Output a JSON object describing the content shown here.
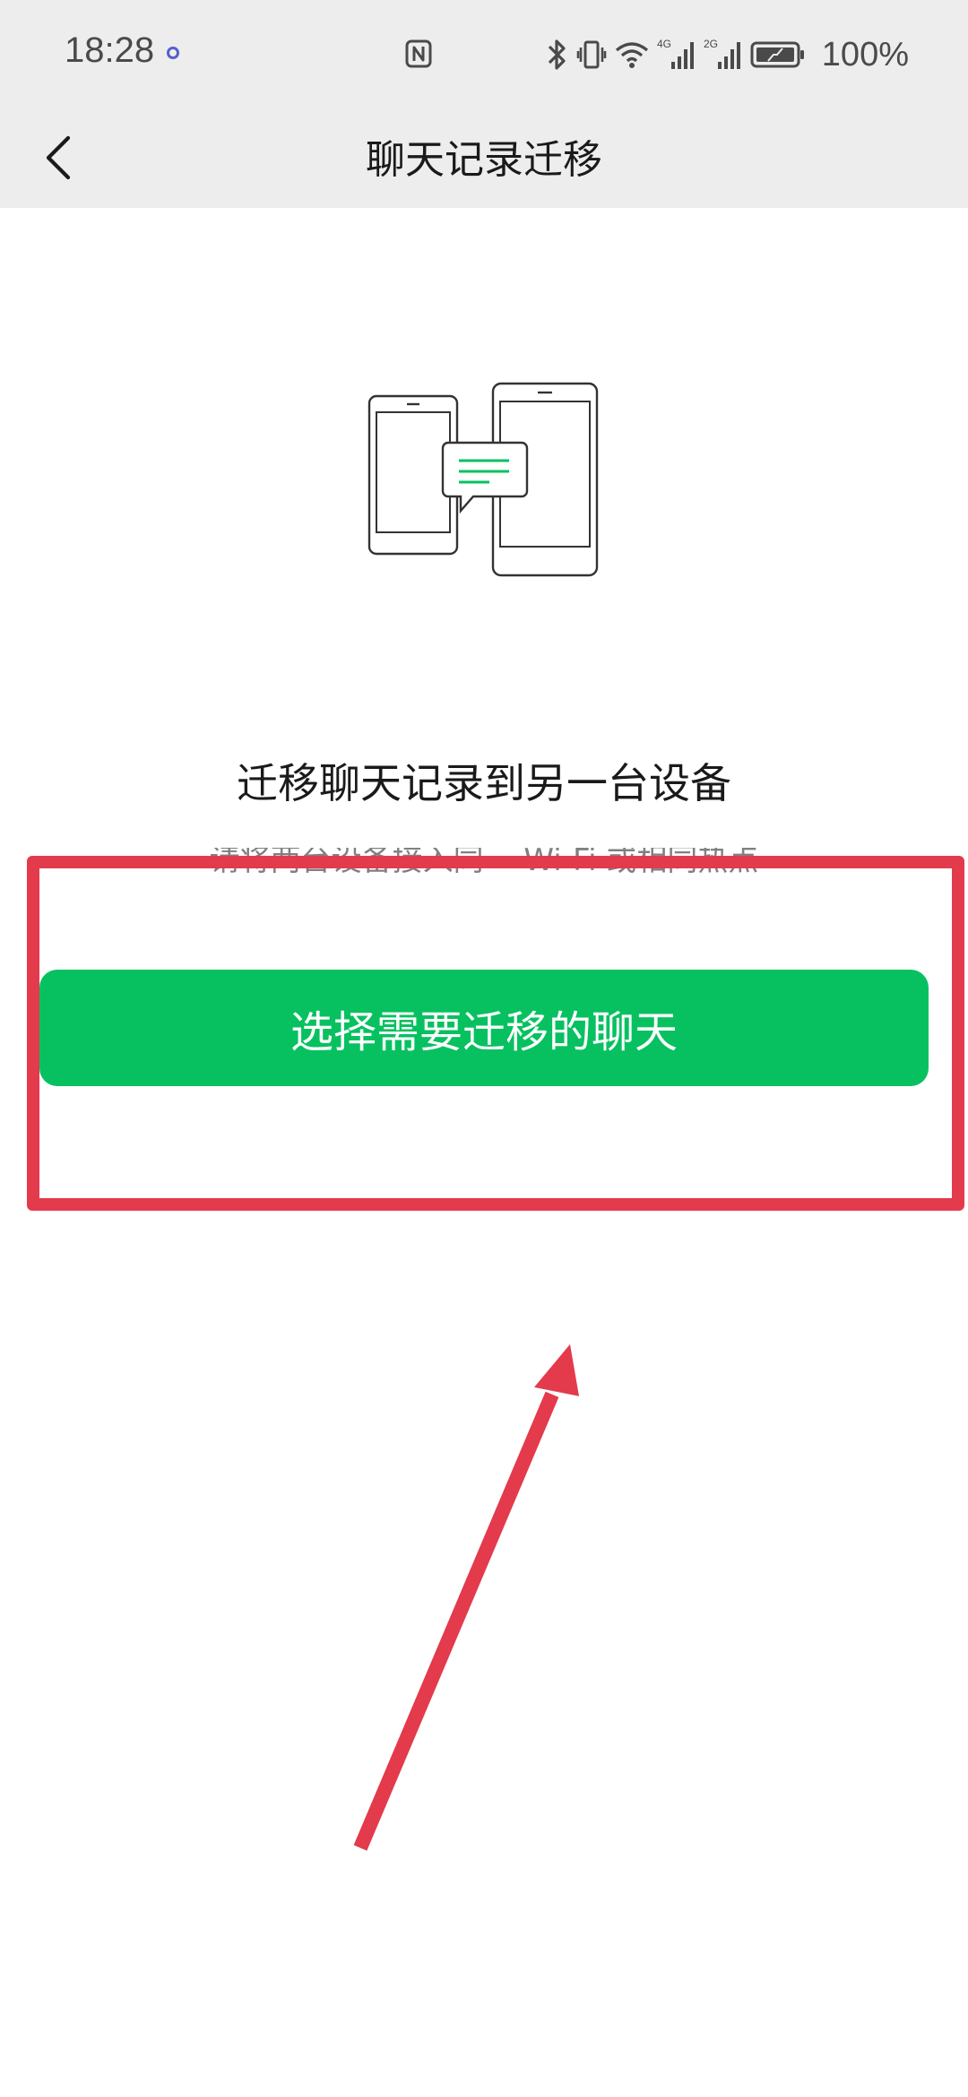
{
  "status_bar": {
    "time": "18:28",
    "battery": "100%",
    "network_1": "4G",
    "network_2": "2G"
  },
  "nav": {
    "title": "聊天记录迁移",
    "back_icon": "chevron-left-icon"
  },
  "main": {
    "illustration_icon": "two-phones-transfer-icon",
    "headline": "迁移聊天记录到另一台设备",
    "subtext": "请将两台设备接入同一 Wi-Fi 或相同热点",
    "button_label": "选择需要迁移的聊天"
  },
  "annotations": {
    "highlight_color": "#e33a4c",
    "arrow_color": "#e33a4c"
  },
  "colors": {
    "accent": "#07c160",
    "header_bg": "#ededed"
  }
}
